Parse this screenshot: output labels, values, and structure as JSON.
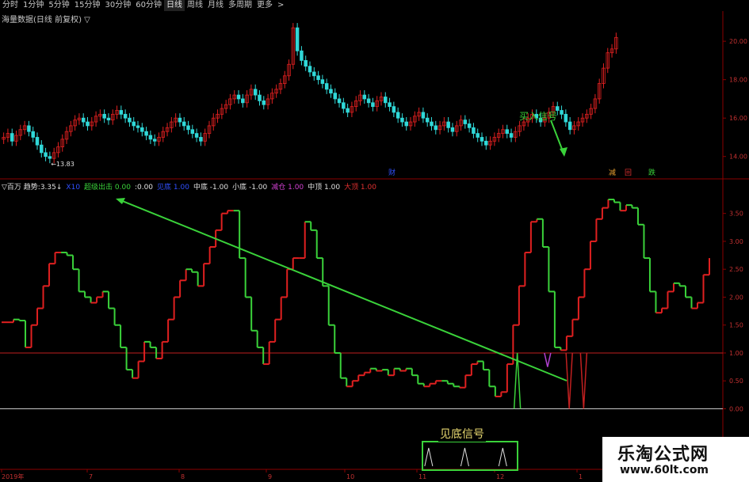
{
  "toolbar": {
    "items": [
      {
        "label": "分时",
        "active": false
      },
      {
        "label": "1分钟",
        "active": false
      },
      {
        "label": "5分钟",
        "active": false
      },
      {
        "label": "15分钟",
        "active": false
      },
      {
        "label": "30分钟",
        "active": false
      },
      {
        "label": "60分钟",
        "active": false
      },
      {
        "label": "日线",
        "active": true
      },
      {
        "label": "周线",
        "active": false
      },
      {
        "label": "月线",
        "active": false
      },
      {
        "label": "多周期",
        "active": false
      },
      {
        "label": "更多",
        "active": false
      }
    ]
  },
  "main_panel": {
    "title": "海量数据(日线 前复权) ▽",
    "min_price_label": "13.83",
    "event_markers": [
      "财",
      "减",
      "回",
      "跌"
    ]
  },
  "indicator_panel": {
    "name": "▽百万",
    "fields": [
      {
        "label": "趋势:",
        "value": "3.35↓",
        "color": "#e0e0e0"
      },
      {
        "label": "",
        "value": "X10",
        "color": "#3050ff"
      },
      {
        "label": "超级出击",
        "value": "0.00",
        "color": "#3ad23a"
      },
      {
        "label": ":",
        "value": "0.00",
        "color": "#e0e0e0"
      },
      {
        "label": "见底",
        "value": "1.00",
        "color": "#3050ff"
      },
      {
        "label": "中底",
        "value": "-1.00",
        "color": "#e0e0e0"
      },
      {
        "label": "小底",
        "value": "-1.00",
        "color": "#e0e0e0"
      },
      {
        "label": "减仓",
        "value": "1.00",
        "color": "#d040d0"
      },
      {
        "label": "中顶",
        "value": "1.00",
        "color": "#e0e0e0"
      },
      {
        "label": "大顶",
        "value": "1.00",
        "color": "#e03030"
      }
    ]
  },
  "annotations": {
    "buy_signal": "买入信号",
    "bottom_signal": "见底信号"
  },
  "watermark": {
    "name": "乐淘公式网",
    "url": "www.60lt.com"
  },
  "colors": {
    "up": "#e02020",
    "down": "#30d8d8",
    "trend_up": "#e02020",
    "trend_down": "#3ad23a",
    "grid": "#8b0000",
    "axis_text": "#c03030",
    "annotation": "#3ad23a"
  },
  "chart_data": [
    {
      "type": "candlestick",
      "title": "海量数据(日线 前复权)",
      "y_ticks": [
        "20.00",
        "18.00",
        "16.00",
        "14.00"
      ],
      "ylim": [
        13.0,
        20.5
      ],
      "closes": [
        15.0,
        15.2,
        14.8,
        15.1,
        15.4,
        15.6,
        15.3,
        15.0,
        14.6,
        14.2,
        14.0,
        13.9,
        14.2,
        14.5,
        14.9,
        15.3,
        15.6,
        15.9,
        16.0,
        15.8,
        15.6,
        15.8,
        16.1,
        16.2,
        16.0,
        15.9,
        16.2,
        16.4,
        16.2,
        16.0,
        15.8,
        15.6,
        15.5,
        15.3,
        15.1,
        14.9,
        14.8,
        15.0,
        15.3,
        15.5,
        15.8,
        16.0,
        15.8,
        15.6,
        15.4,
        15.2,
        15.0,
        14.8,
        15.2,
        15.6,
        16.0,
        16.2,
        16.5,
        16.7,
        17.0,
        17.2,
        17.0,
        16.8,
        17.2,
        17.5,
        17.2,
        16.9,
        16.7,
        17.0,
        17.3,
        17.5,
        17.8,
        18.2,
        18.8,
        20.7,
        19.5,
        19.0,
        18.7,
        18.4,
        18.2,
        18.0,
        17.8,
        17.5,
        17.3,
        17.0,
        16.8,
        16.5,
        16.3,
        16.6,
        16.9,
        17.2,
        17.0,
        16.8,
        16.6,
        16.9,
        17.1,
        16.8,
        16.6,
        16.3,
        16.0,
        15.8,
        15.6,
        15.8,
        16.1,
        16.3,
        16.0,
        15.8,
        15.6,
        15.4,
        15.6,
        15.8,
        15.5,
        15.3,
        15.6,
        15.9,
        15.7,
        15.5,
        15.2,
        15.0,
        14.8,
        14.6,
        14.8,
        15.0,
        15.2,
        15.4,
        15.2,
        15.0,
        15.3,
        15.6,
        15.8,
        16.0,
        16.2,
        16.0,
        15.8,
        16.0,
        16.3,
        16.6,
        16.4,
        16.2,
        15.8,
        15.4,
        15.6,
        15.8,
        16.0,
        16.2,
        16.5,
        17.0,
        17.8,
        18.6,
        19.4,
        19.6,
        20.2
      ]
    },
    {
      "type": "line",
      "title": "百万",
      "y_ticks": [
        "3.50",
        "3.00",
        "2.50",
        "2.00",
        "1.50",
        "1.00",
        "0.50",
        "0.00"
      ],
      "ylim": [
        -0.05,
        3.85
      ],
      "reference_lines": [
        1.0,
        0.0
      ],
      "x_ticks": [
        "2019年",
        "7",
        "8",
        "9",
        "10",
        "11",
        "12",
        "1"
      ],
      "values": [
        1.55,
        1.55,
        1.6,
        1.58,
        1.1,
        1.5,
        1.8,
        2.2,
        2.6,
        2.8,
        2.8,
        2.75,
        2.5,
        2.1,
        2.0,
        1.9,
        2.0,
        2.1,
        1.8,
        1.5,
        1.1,
        0.7,
        0.55,
        0.85,
        1.2,
        1.1,
        0.9,
        1.2,
        1.6,
        2.0,
        2.3,
        2.5,
        2.45,
        2.2,
        2.6,
        2.9,
        3.2,
        3.5,
        3.55,
        3.55,
        2.7,
        2.0,
        1.4,
        1.1,
        0.8,
        1.2,
        1.6,
        2.0,
        2.5,
        2.7,
        2.7,
        3.35,
        3.2,
        2.7,
        2.2,
        1.5,
        1.0,
        0.55,
        0.4,
        0.5,
        0.6,
        0.65,
        0.72,
        0.68,
        0.7,
        0.6,
        0.72,
        0.68,
        0.72,
        0.6,
        0.45,
        0.4,
        0.45,
        0.5,
        0.5,
        0.45,
        0.4,
        0.38,
        0.6,
        0.8,
        0.85,
        0.7,
        0.4,
        0.22,
        0.3,
        0.8,
        1.5,
        2.2,
        2.8,
        3.35,
        3.4,
        2.9,
        2.1,
        1.1,
        1.05,
        1.3,
        1.6,
        2.0,
        2.5,
        3.0,
        3.4,
        3.6,
        3.75,
        3.7,
        3.55,
        3.65,
        3.6,
        3.3,
        2.7,
        2.1,
        1.72,
        1.8,
        2.1,
        2.25,
        2.2,
        2.0,
        1.8,
        1.9,
        2.4,
        2.7
      ],
      "signals": {
        "bottom_spikes_x": [
          0.06,
          0.46,
          0.88
        ],
        "green_spike_at": 0.715,
        "purple_spike_at": 0.757,
        "red_spikes_at": [
          0.787,
          0.807
        ]
      }
    }
  ]
}
